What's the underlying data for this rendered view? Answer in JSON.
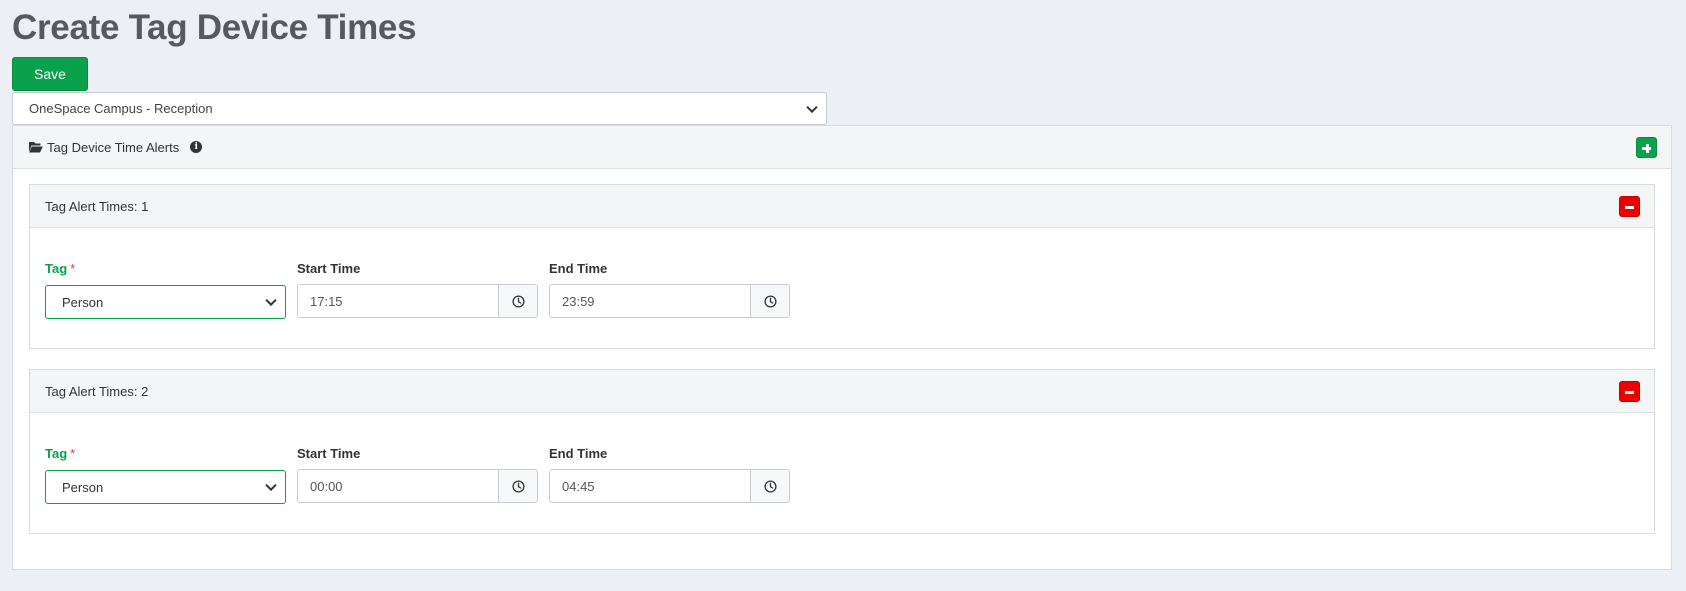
{
  "page": {
    "title": "Create Tag Device Times"
  },
  "toolbar": {
    "save_label": "Save"
  },
  "location": {
    "selected": "OneSpace Campus - Reception"
  },
  "main_panel": {
    "title": "Tag Device Time Alerts"
  },
  "alert_blocks": [
    {
      "title": "Tag Alert Times: 1",
      "tag_label": "Tag",
      "required_mark": "*",
      "tag_value": "Person",
      "start_label": "Start Time",
      "start_value": "17:15",
      "end_label": "End Time",
      "end_value": "23:59"
    },
    {
      "title": "Tag Alert Times: 2",
      "tag_label": "Tag",
      "required_mark": "*",
      "tag_value": "Person",
      "start_label": "Start Time",
      "start_value": "00:00",
      "end_label": "End Time",
      "end_value": "04:45"
    }
  ],
  "colors": {
    "primary_green": "#0aa14c",
    "danger_red": "#ee0000",
    "page_bg": "#eceff3"
  },
  "icons": {
    "folder": "folder-open-icon",
    "info": "info-icon",
    "add": "plus-icon",
    "remove": "minus-icon",
    "clock": "clock-icon",
    "dropdown": "chevron-down-icon"
  }
}
